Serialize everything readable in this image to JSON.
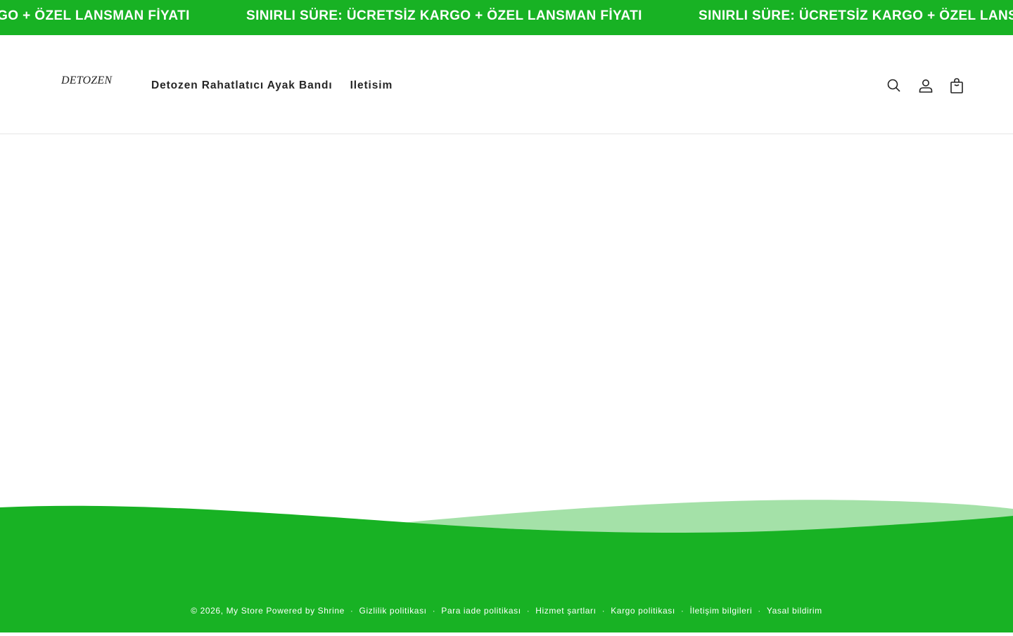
{
  "announcement": {
    "text": "SINIRLI SÜRE: ÜCRETSİZ KARGO + ÖZEL LANSMAN FİYATI",
    "background": "#18b224"
  },
  "header": {
    "logo_text": "DETOZEN",
    "nav": [
      {
        "label": "Detozen Rahatlatıcı Ayak Bandı"
      },
      {
        "label": "Iletisim"
      }
    ],
    "icons": [
      "search-icon",
      "account-icon",
      "cart-icon"
    ]
  },
  "footer": {
    "copyright": "© 2026,",
    "store_name": "My Store",
    "powered_by": "Powered by Shrine",
    "links": [
      "Gizlilik politikası",
      "Para iade politikası",
      "Hizmet şartları",
      "Kargo politikası",
      "İletişim bilgileri",
      "Yasal bildirim"
    ],
    "color": "#18b224"
  }
}
